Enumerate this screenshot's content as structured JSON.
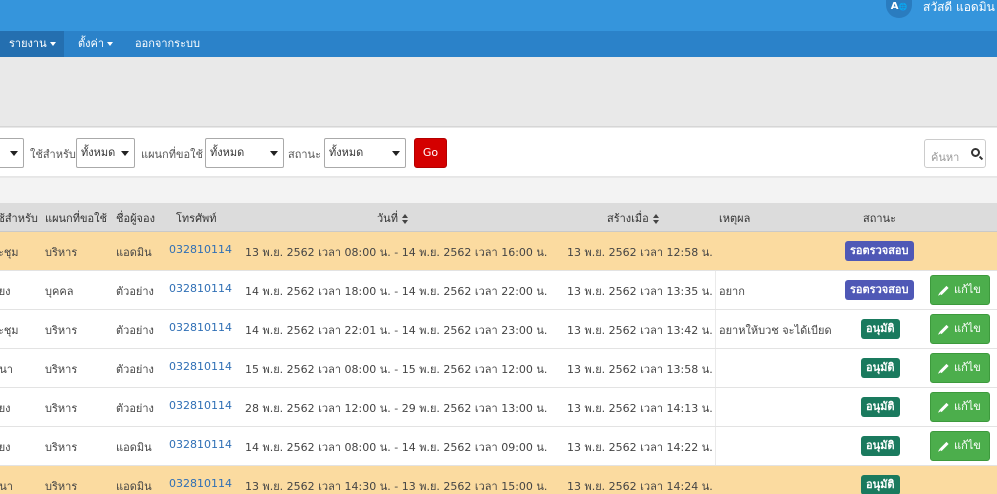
{
  "header": {
    "avatar_text": "A",
    "greeting": "สวัสดี แอดมิน"
  },
  "nav": {
    "items": [
      {
        "label": "รายงาน",
        "has_caret": true,
        "active": true
      },
      {
        "label": "ตั้งค่า",
        "has_caret": true,
        "active": false
      },
      {
        "label": "ออกจากระบบ",
        "has_caret": false,
        "active": false
      }
    ]
  },
  "filters": {
    "for_label": "ใช้สำหรับ",
    "for_value": "ทั้งหมด",
    "dept_label": "แผนกที่ขอใช้",
    "dept_value": "ทั้งหมด",
    "status_label": "สถานะ",
    "status_value": "ทั้งหมด",
    "go_label": "Go",
    "search_placeholder": "ค้นหา"
  },
  "table": {
    "headers": {
      "purpose": "ใช้สำหรับ",
      "dept": "แผนกที่ขอใช้",
      "booker": "ชื่อผู้จอง",
      "phone": "โทรศัพท์",
      "date": "วันที่",
      "created": "สร้างเมื่อ",
      "reason": "เหตุผล",
      "status": "สถานะ"
    },
    "edit_label": "แก้ไข",
    "rows": [
      {
        "purpose": "ระชุม",
        "dept": "บริหาร",
        "booker": "แอดมิน",
        "phone": "032810114",
        "date": "13 พ.ย. 2562 เวลา 08:00 น. - 14 พ.ย. 2562 เวลา 16:00 น.",
        "created": "13 พ.ย. 2562 เวลา 12:58 น.",
        "reason": "",
        "status": "รอตรวจสอบ",
        "status_type": "waiting",
        "editable": false,
        "highlight": true
      },
      {
        "purpose": "ลี้ยง",
        "dept": "บุคคล",
        "booker": "ตัวอย่าง",
        "phone": "032810114",
        "date": "14 พ.ย. 2562 เวลา 18:00 น. - 14 พ.ย. 2562 เวลา 22:00 น.",
        "created": "13 พ.ย. 2562 เวลา 13:35 น.",
        "reason": "อยาก",
        "status": "รอตรวจสอบ",
        "status_type": "waiting",
        "editable": true,
        "highlight": false
      },
      {
        "purpose": "ระชุม",
        "dept": "บริหาร",
        "booker": "ตัวอย่าง",
        "phone": "032810114",
        "date": "14 พ.ย. 2562 เวลา 22:01 น. - 14 พ.ย. 2562 เวลา 23:00 น.",
        "created": "13 พ.ย. 2562 เวลา 13:42 น.",
        "reason": "อยาหให้บวช จะได้เบียด",
        "status": "อนุมัติ",
        "status_type": "approved",
        "editable": true,
        "highlight": false
      },
      {
        "purpose": "มนา",
        "dept": "บริหาร",
        "booker": "ตัวอย่าง",
        "phone": "032810114",
        "date": "15 พ.ย. 2562 เวลา 08:00 น. - 15 พ.ย. 2562 เวลา 12:00 น.",
        "created": "13 พ.ย. 2562 เวลา 13:58 น.",
        "reason": "",
        "status": "อนุมัติ",
        "status_type": "approved",
        "editable": true,
        "highlight": false
      },
      {
        "purpose": "ลี้ยง",
        "dept": "บริหาร",
        "booker": "ตัวอย่าง",
        "phone": "032810114",
        "date": "28 พ.ย. 2562 เวลา 12:00 น. - 29 พ.ย. 2562 เวลา 13:00 น.",
        "created": "13 พ.ย. 2562 เวลา 14:13 น.",
        "reason": "",
        "status": "อนุมัติ",
        "status_type": "approved",
        "editable": true,
        "highlight": false
      },
      {
        "purpose": "ลี้ยง",
        "dept": "บริหาร",
        "booker": "แอดมิน",
        "phone": "032810114",
        "date": "14 พ.ย. 2562 เวลา 08:00 น. - 14 พ.ย. 2562 เวลา 09:00 น.",
        "created": "13 พ.ย. 2562 เวลา 14:22 น.",
        "reason": "",
        "status": "อนุมัติ",
        "status_type": "approved",
        "editable": true,
        "highlight": false
      },
      {
        "purpose": "มนา",
        "dept": "บริหาร",
        "booker": "แอดมิน",
        "phone": "032810114",
        "date": "13 พ.ย. 2562 เวลา 14:30 น. - 13 พ.ย. 2562 เวลา 15:00 น.",
        "created": "13 พ.ย. 2562 เวลา 14:24 น.",
        "reason": "",
        "status": "อนุมัติ",
        "status_type": "approved",
        "editable": false,
        "highlight": true
      }
    ]
  },
  "colors": {
    "topbar": "#3595dc",
    "navbar": "#2b82c9",
    "go_button": "#d40000",
    "waiting_badge": "#4f58b6",
    "approved_badge": "#1a7a5e",
    "edit_button": "#4cae4c",
    "highlight_row": "#fbdba0"
  }
}
